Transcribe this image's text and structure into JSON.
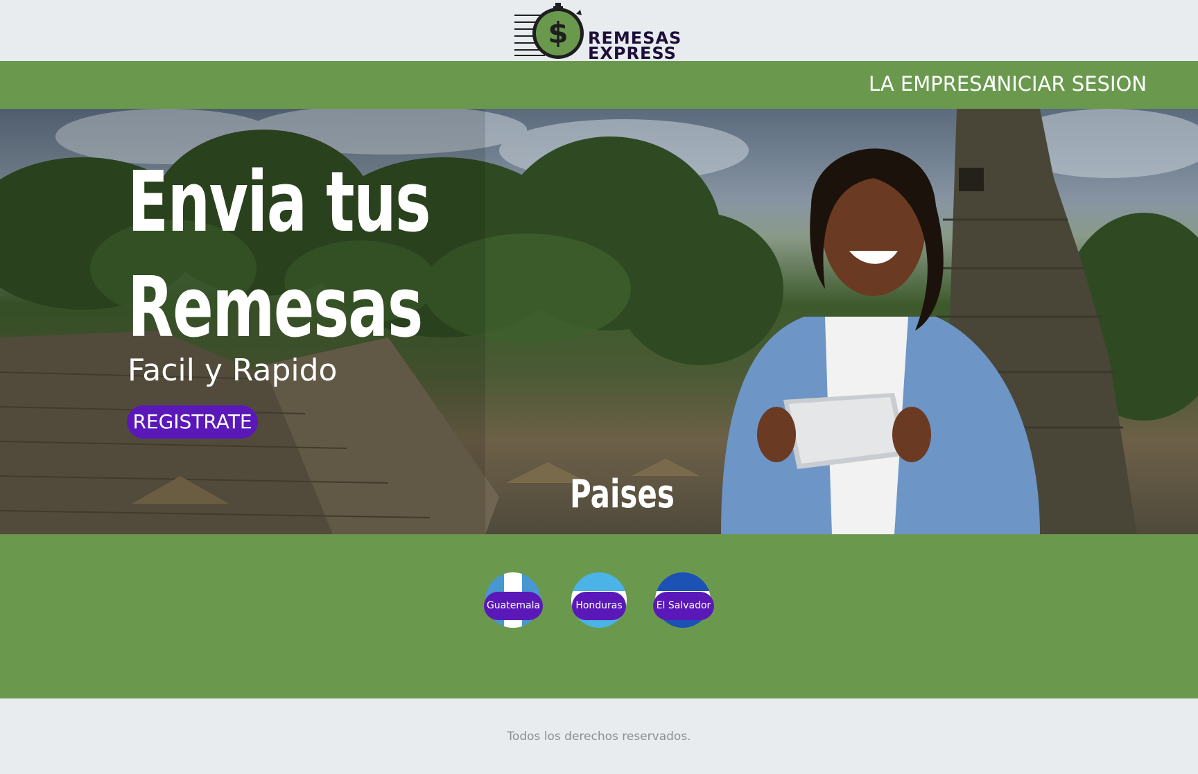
{
  "logo": {
    "line1": "REMESAS",
    "line2": "EXPRESS",
    "symbol": "$"
  },
  "nav": {
    "empresa": "LA EMPRESA",
    "login": "INICIAR SESION"
  },
  "hero": {
    "title_line1": "Envia tus",
    "title_line2": "Remesas",
    "subtitle": "Facil y Rapido",
    "cta": "REGISTRATE"
  },
  "countries": {
    "title": "Paises",
    "items": [
      {
        "label": "Guatemala",
        "flag": "guatemala-flag-icon"
      },
      {
        "label": "Honduras",
        "flag": "honduras-flag-icon"
      },
      {
        "label": "El Salvador",
        "flag": "el-salvador-flag-icon"
      }
    ]
  },
  "footer": {
    "text": "Todos los derechos reservados."
  },
  "colors": {
    "brand_green": "#6a994e",
    "accent_purple": "#5a18b8",
    "background": "#e8ecef"
  }
}
